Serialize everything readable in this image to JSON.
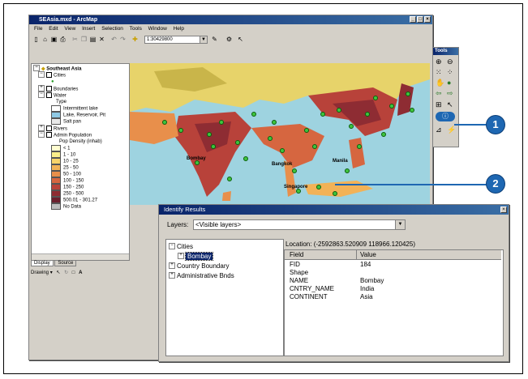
{
  "arcmap": {
    "title": "SEAsia.mxd - ArcMap",
    "window_buttons": [
      "_",
      "□",
      "×"
    ],
    "menu": [
      "File",
      "Edit",
      "View",
      "Insert",
      "Selection",
      "Tools",
      "Window",
      "Help"
    ],
    "scale": "1:30429800",
    "toc": {
      "root": "Southeast Asia",
      "layers": [
        {
          "label": "Cities",
          "indent": 1,
          "checked": true
        },
        {
          "label": "Boundaries",
          "indent": 1,
          "checked": true
        },
        {
          "label": "Water",
          "indent": 1,
          "checked": true
        },
        {
          "label": "Type",
          "indent": 3,
          "checked": null
        },
        {
          "label": "Intermittent lake",
          "indent": 3,
          "swatch": "#ffffff"
        },
        {
          "label": "Lake, Reservoir, Pit",
          "indent": 3,
          "swatch": "#8fc9e4"
        },
        {
          "label": "Salt pan",
          "indent": 3,
          "swatch": "#e8e8e8"
        },
        {
          "label": "Rivers",
          "indent": 1,
          "checked": true
        },
        {
          "label": "Admin Population",
          "indent": 1,
          "checked": true
        },
        {
          "label": "Pop Density (inhab)",
          "indent": 4,
          "checked": null
        }
      ],
      "legend": [
        {
          "label": "< 1",
          "color": "#fffdd0"
        },
        {
          "label": "1 - 10",
          "color": "#fbee8a"
        },
        {
          "label": "10 - 25",
          "color": "#f8d36a"
        },
        {
          "label": "25 - 50",
          "color": "#f2b257"
        },
        {
          "label": "50 - 100",
          "color": "#e88f4b"
        },
        {
          "label": "100 - 150",
          "color": "#d66640"
        },
        {
          "label": "150 - 250",
          "color": "#b8423a"
        },
        {
          "label": "250 - 500",
          "color": "#8e2c33"
        },
        {
          "label": "500.01 - 301.27",
          "color": "#6b1f2d"
        },
        {
          "label": "No Data",
          "color": "#bdbdbd"
        }
      ],
      "tabs": [
        "Display",
        "Source"
      ]
    },
    "drawing_label": "Drawing",
    "map_labels": [
      "Bombay",
      "Manila",
      "Bangkok",
      "Singapore"
    ]
  },
  "tools_window": {
    "title": "Tools"
  },
  "identify": {
    "title": "Identify Results",
    "layers_label": "Layers:",
    "layers_value": "<Visible layers>",
    "tree": [
      {
        "label": "Cities",
        "level": 0,
        "expander": "−"
      },
      {
        "label": "Bombay",
        "level": 1,
        "expander": "+",
        "selected": true
      },
      {
        "label": "Country Boundary",
        "level": 0,
        "expander": "+"
      },
      {
        "label": "Administrative Bnds",
        "level": 0,
        "expander": "+"
      }
    ],
    "location": "Location: (-2592863.520909  118966.120425)",
    "columns": [
      "Field",
      "Value"
    ],
    "rows": [
      {
        "field": "FID",
        "value": "184"
      },
      {
        "field": "Shape",
        "value": ""
      },
      {
        "field": "NAME",
        "value": "Bombay"
      },
      {
        "field": "CNTRY_NAME",
        "value": "India"
      },
      {
        "field": "CONTINENT",
        "value": "Asia"
      }
    ]
  },
  "callouts": [
    "1",
    "2"
  ]
}
